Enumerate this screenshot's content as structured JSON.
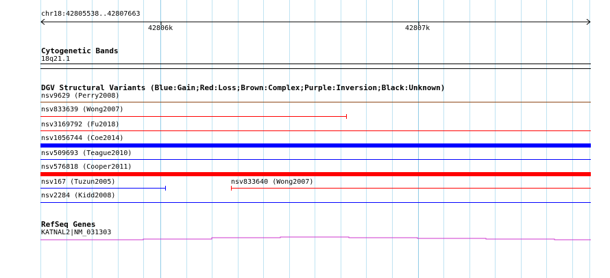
{
  "ruler": {
    "range_label": "chr18:42805538..42807663",
    "tick_labels": [
      "42806k",
      "42807k"
    ]
  },
  "cytoband": {
    "title": "Cytogenetic Bands",
    "band": "18q21.1"
  },
  "dgv": {
    "title": "DGV Structural Variants (Blue:Gain;Red:Loss;Brown:Complex;Purple:Inversion;Black:Unknown)",
    "variants": [
      {
        "label": "nsv9629 (Perry2008)",
        "color": "#8b4513"
      },
      {
        "label": "nsv833639 (Wong2007)",
        "color": "#ff0000"
      },
      {
        "label": "nsv3169792 (Fu2018)",
        "color": "#ff0000"
      },
      {
        "label": "nsv1056744 (Coe2014)",
        "color": "#0000ff"
      },
      {
        "label": "nsv509693 (Teague2010)",
        "color": "#0000ff"
      },
      {
        "label": "nsv576818 (Cooper2011)",
        "color": "#ff0000"
      },
      {
        "label": "nsv167 (Tuzun2005)",
        "color": "#0000ff"
      },
      {
        "label": "nsv833640 (Wong2007)",
        "color": "#ff0000"
      },
      {
        "label": "nsv2284 (Kidd2008)",
        "color": "#0000ff"
      }
    ]
  },
  "refseq": {
    "title": "RefSeq Genes",
    "gene": "KATNAL2|NM_031303",
    "color": "#cc33cc"
  }
}
